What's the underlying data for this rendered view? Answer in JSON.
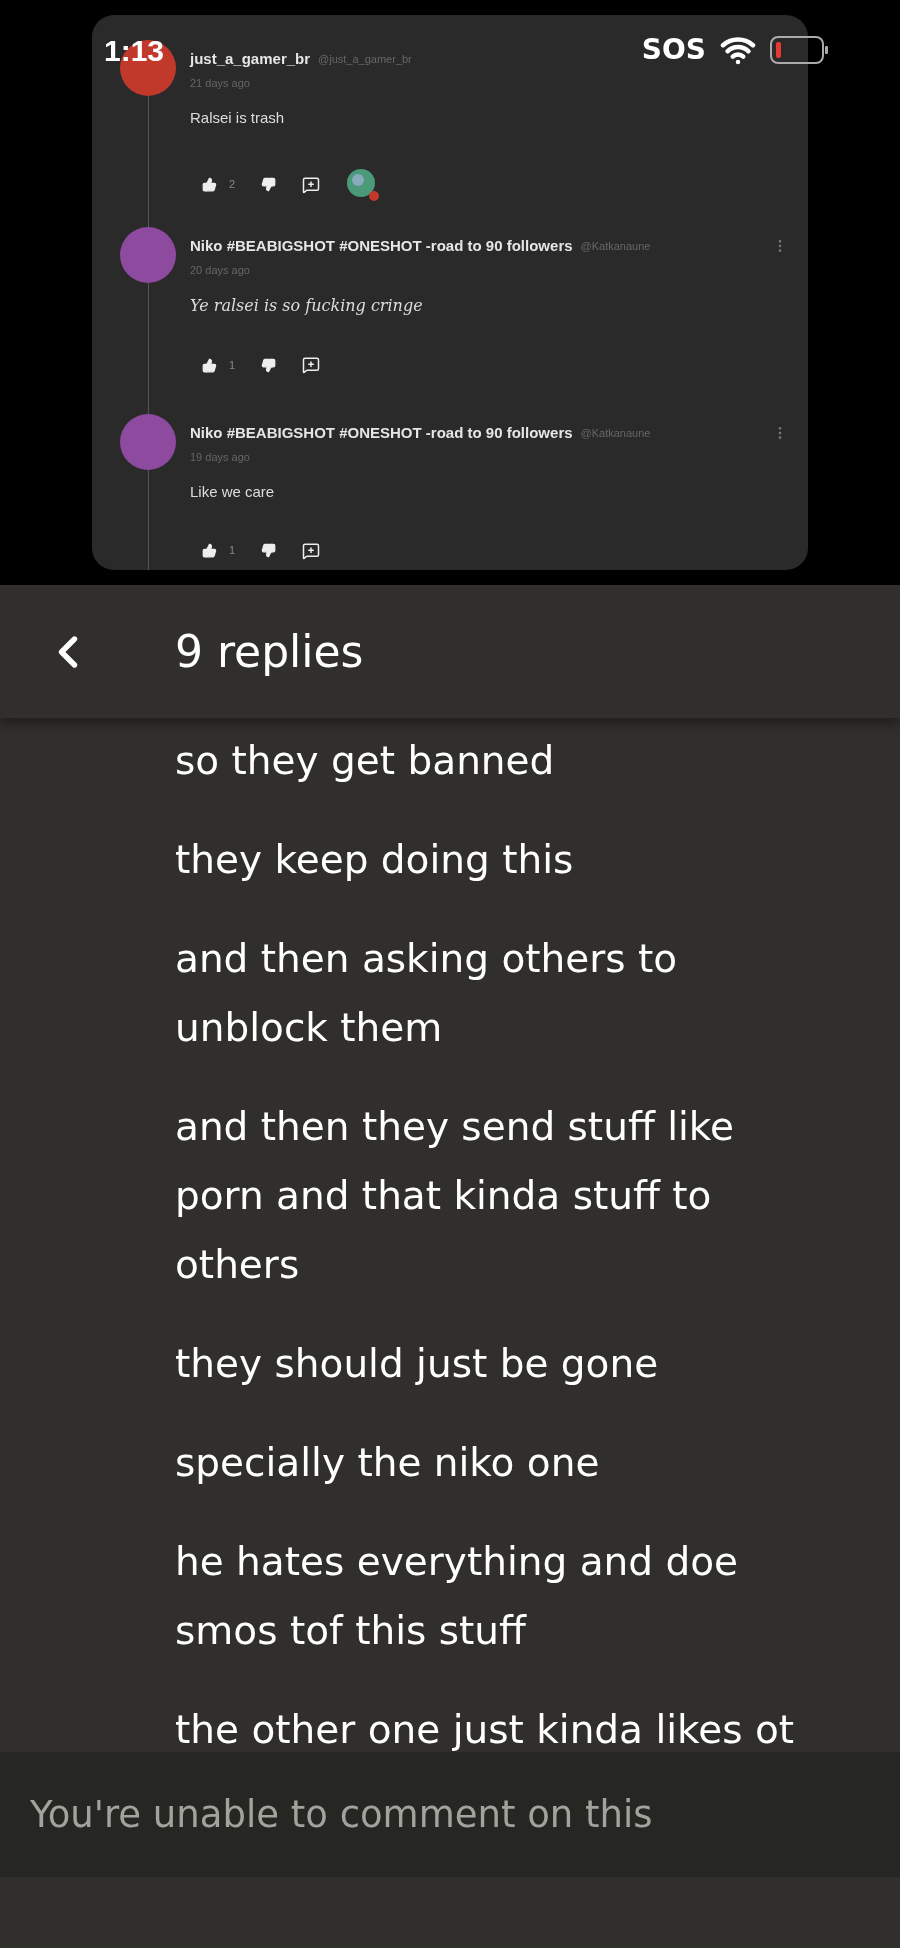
{
  "status_bar": {
    "time": "1:13",
    "carrier": "SOS"
  },
  "post_image": {
    "comments": [
      {
        "name": "just_a_gamer_br",
        "handle": "@just_a_gamer_br",
        "time": "21 days ago",
        "text": "Ralsei is trash",
        "kind": "plain",
        "likes": "2",
        "color": "#c0392b",
        "has_reaction": true,
        "has_menu": false
      },
      {
        "name": "Niko #BEABIGSHOT #ONESHOT -road to 90 followers",
        "handle": "@Katkanaune",
        "time": "20 days ago",
        "text": "Ye ralsei is so fucking cringe",
        "kind": "script",
        "likes": "1",
        "color": "#8e4a9e",
        "has_reaction": false,
        "has_menu": true
      },
      {
        "name": "Niko #BEABIGSHOT #ONESHOT -road to 90 followers",
        "handle": "@Katkanaune",
        "time": "19 days ago",
        "text": "Like we care",
        "kind": "plain",
        "likes": "1",
        "color": "#8e4a9e",
        "has_reaction": false,
        "has_menu": true
      }
    ]
  },
  "header": {
    "title": "9 replies"
  },
  "messages": [
    "so they get banned",
    "they keep doing this",
    "and then asking others to unblock them",
    "and then they send stuff like porn and that kinda stuff to others",
    "they should just be gone",
    "specially the niko one",
    "he hates everything and doe smos tof this stuff",
    "the other one just kinda likes ot"
  ],
  "comment_bar": {
    "placeholder": "You're unable to comment on this"
  }
}
